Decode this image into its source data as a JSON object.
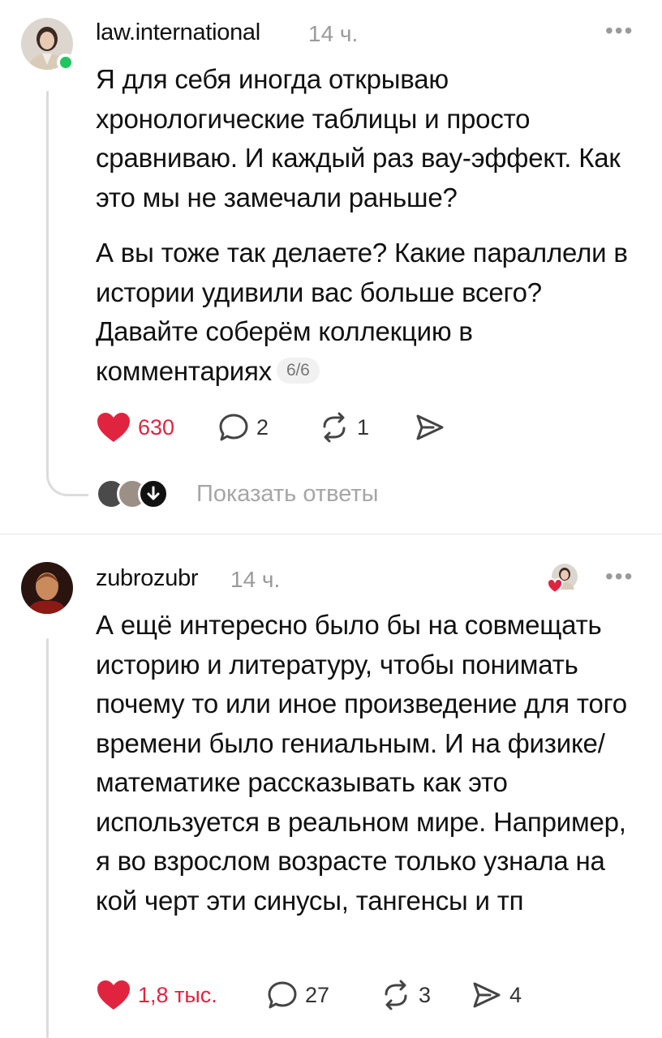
{
  "posts": [
    {
      "username": "law.international",
      "time": "14 ч.",
      "paragraphs": [
        "Я для себя иногда открываю хронологические таблицы и просто сравниваю. И каждый раз вау-эффект. Как это мы не замечали раньше?",
        "А вы тоже так делаете? Какие параллели в истории удивили вас больше всего? Давайте соберём коллекцию в комментариях"
      ],
      "counter": "6/6",
      "likes": "630",
      "replies": "2",
      "reposts": "1",
      "show_replies": "Показать ответы"
    },
    {
      "username": "zubrozubr",
      "time": "14 ч.",
      "paragraphs": [
        "А ещё интересно было бы на совмещать историю и литературу, чтобы понимать почему то или иное произведение для того времени было гениальным. И на физике/математике рассказывать как это используется в реальном мире. Например, я во взрослом возрасте только узнала на кой черт эти синусы, тангенсы и тп"
      ],
      "likes": "1,8 тыс.",
      "replies": "27",
      "reposts": "3",
      "shares": "4"
    }
  ],
  "icons": {
    "more": "more-horizontal-icon",
    "like": "heart-icon",
    "reply": "comment-icon",
    "repost": "repost-icon",
    "share": "send-icon",
    "expand": "arrow-down-icon"
  },
  "colors": {
    "like": "#e0243f",
    "online": "#22c55e",
    "muted": "#9a9a9a"
  }
}
